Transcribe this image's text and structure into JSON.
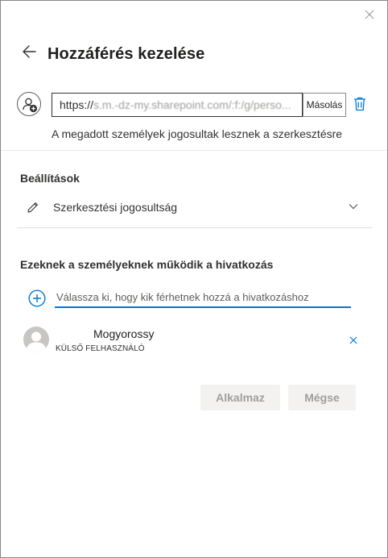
{
  "dialog": {
    "title": "Hozzáférés kezelése",
    "icons": {
      "back": "arrow-left-icon",
      "close": "close-icon",
      "add_person": "add-person-icon",
      "delete": "trash-icon"
    }
  },
  "link": {
    "url_visible": "https://",
    "url_obscured": "s.m.-dz-my.sharepoint.com/:f:/g/perso...",
    "copy_label": "Másolás",
    "description": "A megadott személyek jogosultak lesznek a szerkesztésre"
  },
  "settings": {
    "heading": "Beállítások",
    "permission_label": "Szerkesztési jogosultság",
    "icons": {
      "permission": "pencil-icon",
      "dropdown": "chevron-down-icon"
    }
  },
  "people": {
    "heading": "Ezeknek a személyeknek működik a hivatkozás",
    "input_placeholder": "Válassza ki, hogy kik férhetnek hozzá a hivatkozáshoz",
    "items": [
      {
        "name": "Mogyorossy",
        "subtitle": "KÜLSŐ FELHASZNÁLÓ"
      }
    ]
  },
  "actions": {
    "apply_label": "Alkalmaz",
    "cancel_label": "Mégse"
  },
  "colors": {
    "accent": "#0078d4",
    "disabled_bg": "#f3f2f1",
    "disabled_text": "#a19f9d"
  }
}
